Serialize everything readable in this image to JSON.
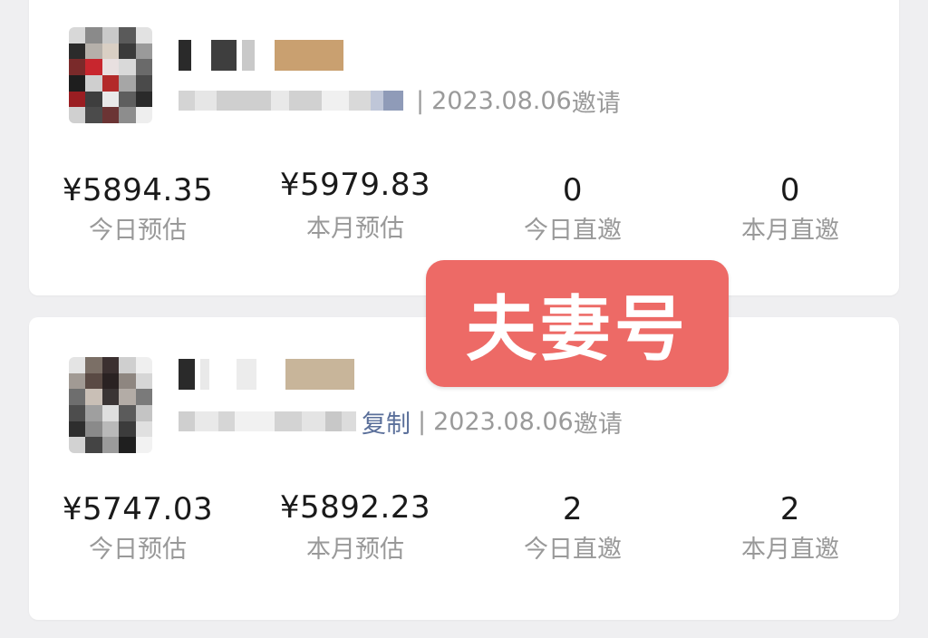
{
  "cards": [
    {
      "copy_link": "",
      "separator": "|",
      "invite_date": "2023.08.06",
      "invite_suffix": "邀请",
      "stats": [
        {
          "value": "¥5894.35",
          "label": "今日预估"
        },
        {
          "value": "¥5979.83",
          "label": "本月预估"
        },
        {
          "value": "0",
          "label": "今日直邀"
        },
        {
          "value": "0",
          "label": "本月直邀"
        }
      ]
    },
    {
      "copy_link": "复制",
      "separator": "|",
      "invite_date": "2023.08.06",
      "invite_suffix": "邀请",
      "stats": [
        {
          "value": "¥5747.03",
          "label": "今日预估"
        },
        {
          "value": "¥5892.23",
          "label": "本月预估"
        },
        {
          "value": "2",
          "label": "今日直邀"
        },
        {
          "value": "2",
          "label": "本月直邀"
        }
      ]
    }
  ],
  "overlay": {
    "text": "夫妻号",
    "color": "#ed6a66"
  }
}
